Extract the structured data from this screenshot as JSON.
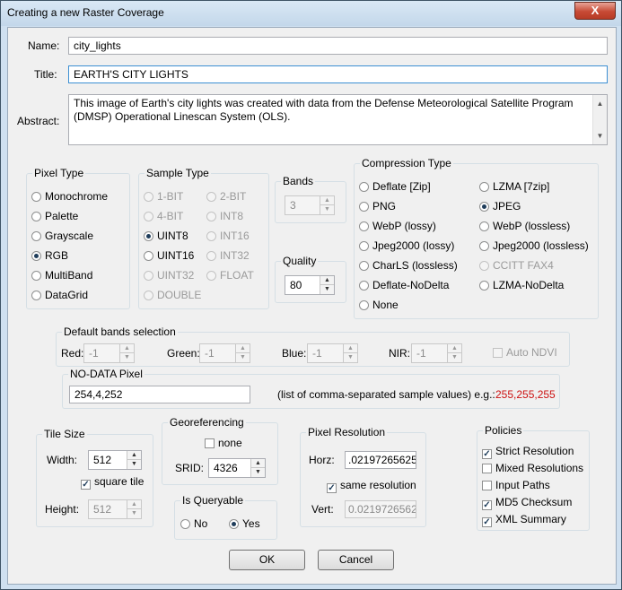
{
  "window": {
    "title": "Creating a new Raster Coverage",
    "close_label": "X"
  },
  "fields": {
    "name_label": "Name:",
    "name_value": "city_lights",
    "title_label": "Title:",
    "title_value": "EARTH'S CITY LIGHTS",
    "abstract_label": "Abstract:",
    "abstract_value": "This image of Earth's city lights was created with data from the Defense Meteorological Satellite Program (DMSP) Operational Linescan System (OLS).",
    "scroll_up": "▲",
    "scroll_down": "▼"
  },
  "pixel_type": {
    "caption": "Pixel Type",
    "options": [
      "Monochrome",
      "Palette",
      "Grayscale",
      "RGB",
      "MultiBand",
      "DataGrid"
    ],
    "selected": "RGB"
  },
  "sample_type": {
    "caption": "Sample Type",
    "options": [
      "1-BIT",
      "2-BIT",
      "4-BIT",
      "INT8",
      "UINT8",
      "INT16",
      "UINT16",
      "INT32",
      "UINT32",
      "FLOAT",
      "DOUBLE"
    ],
    "selected": "UINT8"
  },
  "bands": {
    "caption": "Bands",
    "value": "3"
  },
  "quality": {
    "caption": "Quality",
    "value": "80"
  },
  "compression": {
    "caption": "Compression Type",
    "options": [
      "Deflate [Zip]",
      "LZMA [7zip]",
      "PNG",
      "JPEG",
      "WebP (lossy)",
      "WebP (lossless)",
      "Jpeg2000 (lossy)",
      "Jpeg2000 (lossless)",
      "CharLS (lossless)",
      "CCITT FAX4",
      "Deflate-NoDelta",
      "LZMA-NoDelta",
      "None"
    ],
    "selected": "JPEG"
  },
  "default_bands": {
    "caption": "Default bands selection",
    "red_label": "Red:",
    "red_value": "-1",
    "green_label": "Green:",
    "green_value": "-1",
    "blue_label": "Blue:",
    "blue_value": "-1",
    "nir_label": "NIR:",
    "nir_value": "-1",
    "auto_ndvi": "Auto NDVI"
  },
  "nodata": {
    "caption": "NO-DATA Pixel",
    "value": "254,4,252",
    "hint": "(list of comma-separated sample values) e.g.:",
    "example": "255,255,255"
  },
  "tile": {
    "caption": "Tile Size",
    "width_label": "Width:",
    "width_value": "512",
    "square_label": "square tile",
    "height_label": "Height:",
    "height_value": "512"
  },
  "georef": {
    "caption": "Georeferencing",
    "none_label": "none",
    "srid_label": "SRID:",
    "srid_value": "4326"
  },
  "queryable": {
    "caption": "Is Queryable",
    "no_label": "No",
    "yes_label": "Yes",
    "selected": "Yes"
  },
  "resolution": {
    "caption": "Pixel Resolution",
    "horz_label": "Horz:",
    "horz_value": ".02197265625",
    "same_label": "same resolution",
    "vert_label": "Vert:",
    "vert_value": "0.02197265625"
  },
  "policies": {
    "caption": "Policies",
    "items": [
      {
        "label": "Strict Resolution",
        "checked": true
      },
      {
        "label": "Mixed Resolutions",
        "checked": false
      },
      {
        "label": "Input Paths",
        "checked": false
      },
      {
        "label": "MD5 Checksum",
        "checked": true
      },
      {
        "label": "XML Summary",
        "checked": true
      }
    ]
  },
  "buttons": {
    "ok": "OK",
    "cancel": "Cancel"
  },
  "colors": {
    "accent_red": "#cc1111",
    "frame": "#cfe0f0"
  }
}
